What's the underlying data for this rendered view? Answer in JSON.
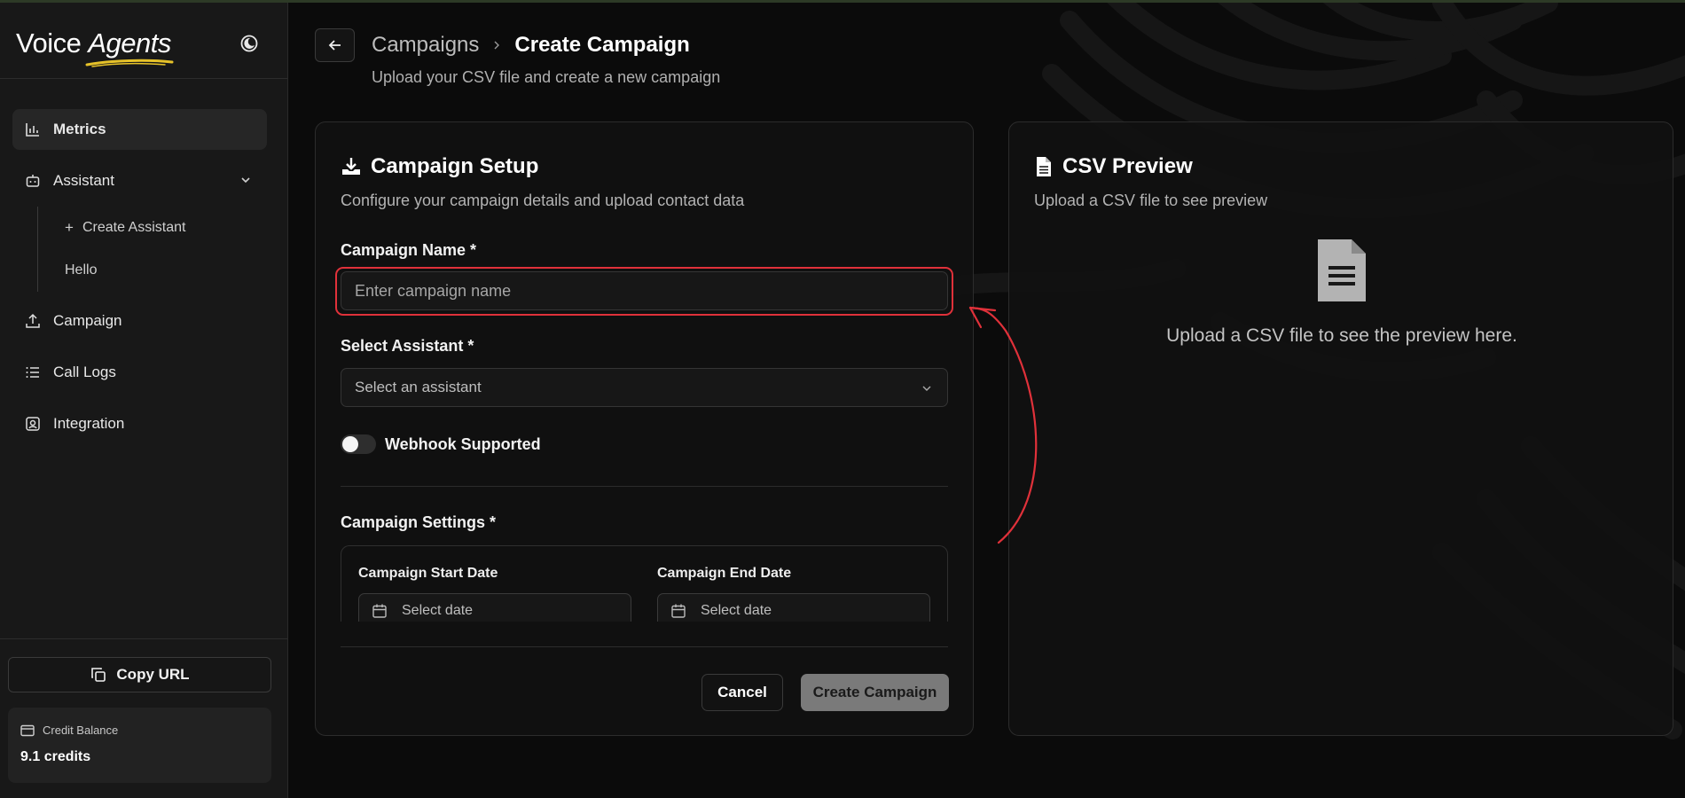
{
  "app": {
    "brand_word1": "Voice",
    "brand_word2": "Agents",
    "accent_color": "#e6c229",
    "theme_toggle_icon": "moon-icon"
  },
  "sidebar": {
    "items": [
      {
        "label": "Metrics",
        "icon": "bar-chart-icon",
        "active": true
      },
      {
        "label": "Assistant",
        "icon": "bot-icon",
        "expanded": true
      },
      {
        "label": "Campaign",
        "icon": "upload-icon"
      },
      {
        "label": "Call Logs",
        "icon": "list-icon"
      },
      {
        "label": "Integration",
        "icon": "integration-icon"
      }
    ],
    "assistant_subitems": [
      {
        "label": "Create Assistant",
        "icon": "plus-icon"
      },
      {
        "label": "Hello"
      }
    ],
    "copy_url_label": "Copy URL",
    "credit_label": "Credit Balance",
    "credit_value": "9.1 credits"
  },
  "header": {
    "breadcrumb_parent": "Campaigns",
    "breadcrumb_current": "Create Campaign",
    "subtitle": "Upload your CSV file and create a new campaign"
  },
  "setup": {
    "title": "Campaign Setup",
    "description": "Configure your campaign details and upload contact data",
    "name_label": "Campaign Name *",
    "name_placeholder": "Enter campaign name",
    "name_value": "",
    "assistant_label": "Select Assistant *",
    "assistant_placeholder": "Select an assistant",
    "webhook_label": "Webhook Supported",
    "webhook_enabled": false,
    "settings_label": "Campaign Settings *",
    "start_date_label": "Campaign Start Date",
    "start_date_value": "Select date",
    "end_date_label": "Campaign End Date",
    "end_date_value": "Select date",
    "cancel_label": "Cancel",
    "create_label": "Create Campaign"
  },
  "preview": {
    "title": "CSV Preview",
    "description": "Upload a CSV file to see preview",
    "empty_text": "Upload a CSV file to see the preview here."
  },
  "annotation": {
    "color": "#e0313a",
    "target": "campaign-name-input"
  }
}
